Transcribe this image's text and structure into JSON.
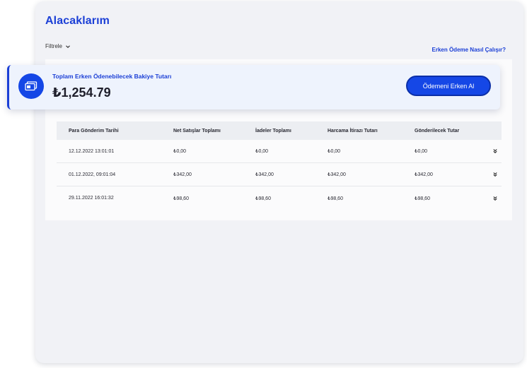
{
  "page": {
    "title": "Alacaklarım",
    "filter_label": "Filtrele",
    "help_link": "Erken Ödeme Nasıl Çalışır?"
  },
  "balance": {
    "label": "Toplam Erken Ödenebilecek Bakiye Tutarı",
    "amount": "₺1,254.79",
    "button_label": "Ödemeni Erken Al",
    "icon": "wallet-icon"
  },
  "table": {
    "headers": [
      "Para Gönderim Tarihi",
      "Net Satışlar Toplamı",
      "İadeler Toplamı",
      "Harcama İtirazı Tutarı",
      "Gönderilecek Tutar"
    ],
    "rows": [
      {
        "date": "12.12.2022  13:01:01",
        "net": "₺0,00",
        "refunds": "₺0,00",
        "disputes": "₺0,00",
        "payout": "₺0,00"
      },
      {
        "date": "01.12.2022, 09:01:04",
        "net": "₺342,00",
        "refunds": "₺342,00",
        "disputes": "₺342,00",
        "payout": "₺342,00"
      },
      {
        "date": "29.11.2022  16:01:32",
        "net": "₺98,60",
        "refunds": "₺98,60",
        "disputes": "₺98,60",
        "payout": "₺98,60"
      }
    ]
  },
  "colors": {
    "accent": "#1b3fd6",
    "button": "#1547e6",
    "background": "#f1f2f6"
  }
}
